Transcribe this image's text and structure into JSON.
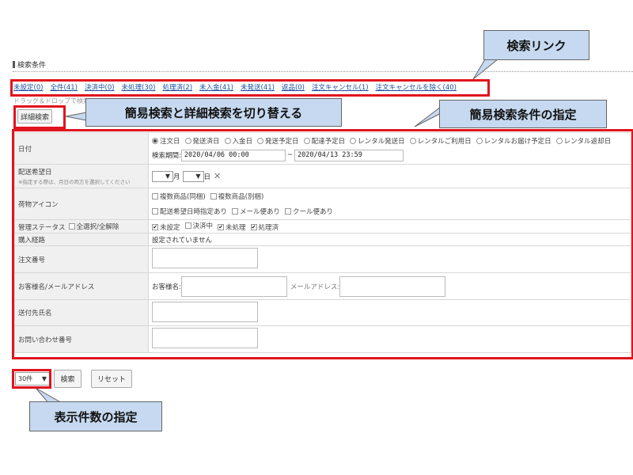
{
  "section_title": "検索条件",
  "callouts": {
    "search_links": "検索リンク",
    "toggle_search": "簡易検索と詳細検索を切り替える",
    "simple_conditions": "簡易検索条件の指定",
    "display_count": "表示件数の指定"
  },
  "status_links": [
    "未設定(0)",
    "全件(41)",
    "決済中(0)",
    "未処理(30)",
    "処理済(2)",
    "未入金(41)",
    "未発送(41)",
    "返品(0)",
    "注文キャンセル(1)",
    "注文キャンセルを除く(40)"
  ],
  "drag_hint": "ドラッグ＆ドロップで検索",
  "detail_search_button": "詳細検索",
  "form": {
    "date": {
      "label": "日付",
      "options": [
        "注文日",
        "発送済日",
        "入金日",
        "発送予定日",
        "配達予定日",
        "レンタル発送日",
        "レンタルご利用日",
        "レンタルお届け予定日",
        "レンタル返却日"
      ],
      "selected": "注文日",
      "period_label": "検索期間:",
      "from": "2020/04/06 00:00",
      "sep": "~",
      "to": "2020/04/13 23:59"
    },
    "delivery_date": {
      "label": "配送希望日",
      "note": "※指定する際は、月日の両方を選択してください",
      "month_suffix": "月",
      "day_suffix": "日",
      "clear": "✕"
    },
    "package_icons": {
      "label": "荷物アイコン",
      "row1": [
        "複数商品(同梱)",
        "複数商品(別梱)"
      ],
      "row2": [
        "配送希望日時指定あり",
        "メール便あり",
        "クール便あり"
      ]
    },
    "management_status": {
      "label": "管理ステータス",
      "toggle_all": "全選択/全解除",
      "items": [
        {
          "label": "未設定",
          "checked": true
        },
        {
          "label": "決済中",
          "checked": false
        },
        {
          "label": "未処理",
          "checked": true
        },
        {
          "label": "処理済",
          "checked": true
        }
      ]
    },
    "purchase_route": {
      "label": "購入経路",
      "value": "設定されていません"
    },
    "order_number": {
      "label": "注文番号",
      "value": ""
    },
    "customer": {
      "label": "お客様名/メールアドレス",
      "name_label": "お客様名:",
      "email_label": "メールアドレス:"
    },
    "recipient": {
      "label": "送付先氏名",
      "value": ""
    },
    "inquiry": {
      "label": "お問い合わせ番号",
      "value": ""
    }
  },
  "bottom": {
    "count_select": "30件",
    "search_button": "検索",
    "reset_button": "リセット"
  },
  "colors": {
    "highlight_red": "#e0141e",
    "callout_bg": "#c6d9f0",
    "link_blue": "#1a4fa0"
  }
}
